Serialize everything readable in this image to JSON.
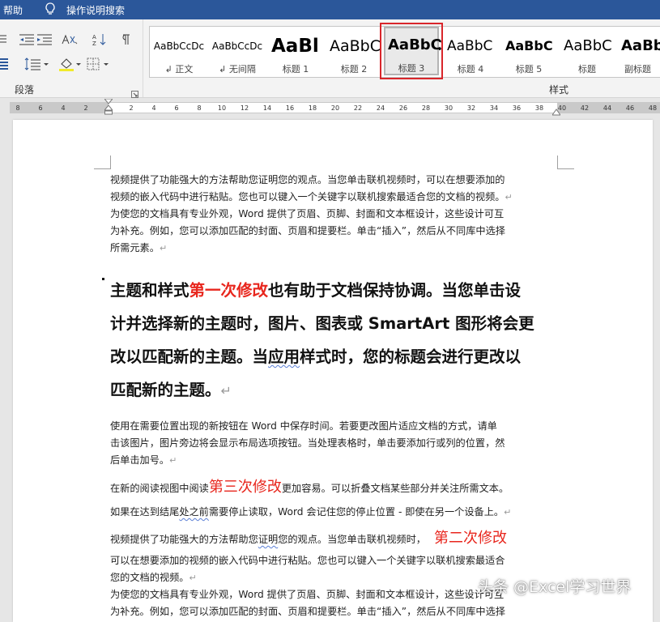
{
  "topbar": {
    "help": "帮助",
    "search": "操作说明搜索"
  },
  "ribbon": {
    "paragraph_group_label": "段落",
    "styles_group_label": "样式",
    "styles": [
      {
        "preview": "AaBbCcDc",
        "name": "↲ 正文"
      },
      {
        "preview": "AaBbCcDc",
        "name": "↲ 无间隔"
      },
      {
        "preview": "AaBl",
        "name": "标题 1"
      },
      {
        "preview": "AaBbC",
        "name": "标题 2"
      },
      {
        "preview": "AaBbC",
        "name": "标题 3",
        "selected": true
      },
      {
        "preview": "AaBbC",
        "name": "标题 4"
      },
      {
        "preview": "AaBbC",
        "name": "标题 5"
      },
      {
        "preview": "AaBbC",
        "name": "标题"
      },
      {
        "preview": "AaBb",
        "name": "副标题"
      }
    ]
  },
  "ruler": {
    "ticks": [
      "8",
      "6",
      "4",
      "2",
      "2",
      "4",
      "6",
      "8",
      "10",
      "12",
      "14",
      "16",
      "18",
      "20",
      "22",
      "24",
      "26",
      "28",
      "30",
      "32",
      "34",
      "36",
      "38",
      "40",
      "42",
      "44",
      "46",
      "48"
    ]
  },
  "document": {
    "para1": [
      "视频提供了功能强大的方法帮助您证明您的观点。当您单击联机视频时，可以在想要添加的",
      "视频的嵌入代码中进行粘贴。您也可以键入一个关键字以联机搜索最适合您的文档的视频。",
      "为使您的文档具有专业外观，Word 提供了页眉、页脚、封面和文本框设计，这些设计可互",
      "为补充。例如，您可以添加匹配的封面、页眉和提要栏。单击“插入”，然后从不同库中选择",
      "所需元素。"
    ],
    "heading": {
      "line1_a": "主题和样式",
      "line1_red": "第一次修改",
      "line1_b": "也有助于文档保持协调。当您单击设",
      "line2": "计并选择新的主题时，图片、图表或 SmartArt 图形将会更",
      "line3_a": "改以匹配新的主题。当",
      "line3_wavy": "应用",
      "line3_b": "样式时，您的标题会进行更改以",
      "line4": "匹配新的主题。"
    },
    "para2": [
      "使用在需要位置出现的新按钮在 Word 中保存时间。若要更改图片适应文档的方式，请单",
      "击该图片，图片旁边将会显示布局选项按钮。当处理表格时，单击要添加行或列的位置，然",
      "后单击加号。"
    ],
    "para3": {
      "a": "在新的阅读视图中阅读",
      "red": "第三次修改",
      "b": "更加容易。可以折叠文档某些部分并关注所需文本。"
    },
    "para4": {
      "a": "如果在达到结尾",
      "wavy": "处之前",
      "b": "需要停止读取，Word 会记住您的停止位置 - 即使在另一个设备上。"
    },
    "para5": {
      "a": "视频提供了功能强大的方法帮助您",
      "wavy": "证明",
      "b": "您的观点。当您单击联机视频时，",
      "red": "第二次修改"
    },
    "para6": [
      "可以在想要添加的视频的嵌入代码中进行粘贴。您也可以键入一个关键字以联机搜索最适合",
      "您的文档的视频。",
      "为使您的文档具有专业外观，Word 提供了页眉、页脚、封面和文本框设计，这些设计可互",
      "为补充。例如，您可以添加匹配的封面、页眉和提要栏。单击“插入”，然后从不同库中选择"
    ]
  },
  "watermark": "头条 @Excel学习世界",
  "colors": {
    "title_bar": "#2b579a",
    "highlight_box": "#d9262b",
    "revision_red": "#e8261d"
  }
}
